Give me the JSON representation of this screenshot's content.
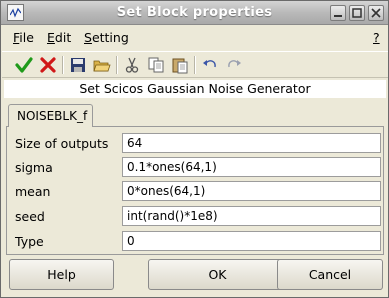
{
  "window": {
    "title": "Set Block properties",
    "icons": [
      "app-plot-icon",
      "minimize-icon",
      "maximize-icon",
      "close-icon"
    ]
  },
  "menu": {
    "file": {
      "first": "F",
      "rest": "ile"
    },
    "edit": {
      "first": "E",
      "rest": "dit"
    },
    "setting": {
      "first": "S",
      "rest": "etting"
    },
    "help": "?"
  },
  "toolbar": {
    "icons": [
      "ok-check-icon",
      "cancel-x-icon",
      "save-icon",
      "open-folder-icon",
      "cut-icon",
      "copy-icon",
      "paste-icon",
      "undo-icon",
      "redo-icon"
    ],
    "colors": {
      "check": "#1f9a1a",
      "cancel": "#d01818"
    }
  },
  "description": "Set Scicos Gaussian Noise Generator",
  "tab": {
    "label": "NOISEBLK_f"
  },
  "params": [
    {
      "label": "Size of outputs",
      "value": "64"
    },
    {
      "label": "sigma",
      "value": "0.1*ones(64,1)"
    },
    {
      "label": "mean",
      "value": "0*ones(64,1)"
    },
    {
      "label": "seed",
      "value": "int(rand()*1e8)"
    },
    {
      "label": "Type",
      "value": "0"
    }
  ],
  "buttons": {
    "help": "Help",
    "ok": "OK",
    "cancel": "Cancel"
  }
}
